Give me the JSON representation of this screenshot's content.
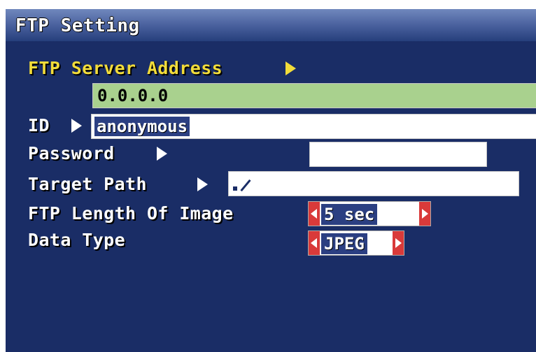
{
  "window": {
    "title": "FTP Setting"
  },
  "fields": {
    "server_address": {
      "label": "FTP Server Address",
      "value": "0.0.0.0"
    },
    "id": {
      "label": "ID",
      "value": "anonymous"
    },
    "password": {
      "label": "Password",
      "value": ""
    },
    "target_path": {
      "label": "Target Path",
      "value": "."
    },
    "image_length": {
      "label": "FTP Length Of Image",
      "value": "5 sec"
    },
    "data_type": {
      "label": "Data Type",
      "value": "JPEG"
    }
  },
  "colors": {
    "background": "#1a2d66",
    "selected_label": "#f2dc3a",
    "selected_field": "#a9d18e",
    "spinner_button": "#d93a3a"
  },
  "icons": {
    "field_pointer": "triangle-right-icon",
    "path_edit": "pencil-icon",
    "spin_prev": "triangle-left-icon",
    "spin_next": "triangle-right-icon"
  }
}
